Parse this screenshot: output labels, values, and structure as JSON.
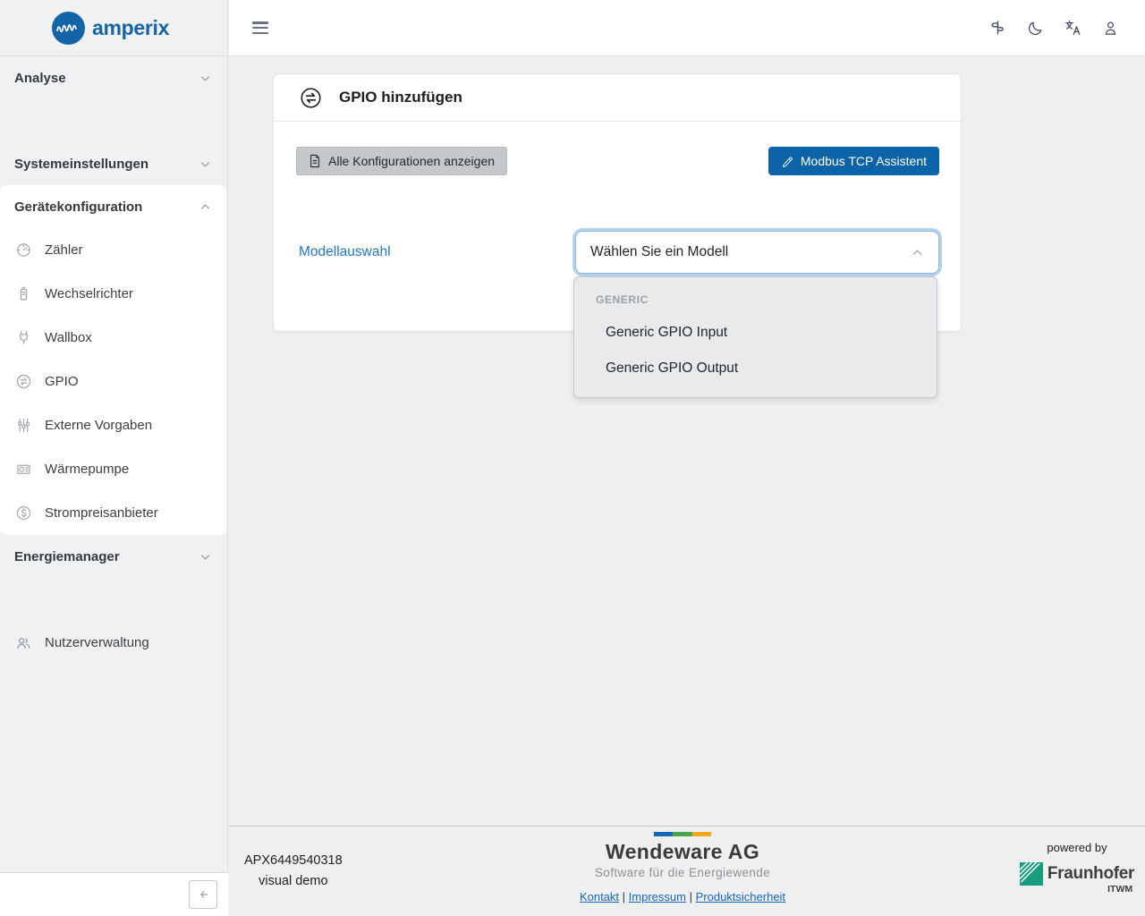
{
  "brand": {
    "name": "amperix"
  },
  "colors": {
    "brand_blue": "#1464a8",
    "button_blue": "#0d63a8",
    "label_blue": "#2377c6",
    "link_blue": "#1766c2",
    "sidebar_bg": "#f0f1f2",
    "content_bg": "#edeff1",
    "fraunhofer_green": "#179c7d",
    "wendeware_bar": [
      "#1268b3",
      "#4ba546",
      "#f5a81c"
    ]
  },
  "icons": {
    "topbar": [
      "signpost-icon",
      "moon-icon",
      "translate-icon",
      "user-icon"
    ],
    "sidebar": [
      "gauge-icon",
      "inverter-icon",
      "plug-icon",
      "swap-arrows-icon",
      "sliders-icon",
      "heat-pump-icon",
      "price-icon",
      "users-icon"
    ],
    "card": [
      "swap-arrows-icon",
      "document-icon",
      "pen-icon"
    ],
    "other": [
      "hamburger-icon",
      "collapse-left-icon",
      "chevron-up-icon",
      "chevron-down-icon"
    ]
  },
  "sidebar": {
    "sections": [
      {
        "label": "Analyse",
        "state": "collapsed"
      },
      {
        "label": "Systemeinstellungen",
        "state": "collapsed"
      },
      {
        "label": "Gerätekonfiguration",
        "state": "expanded",
        "items": [
          "Zähler",
          "Wechselrichter",
          "Wallbox",
          "GPIO",
          "Externe Vorgaben",
          "Wärmepumpe",
          "Strompreisanbieter"
        ]
      },
      {
        "label": "Energiemanager",
        "state": "collapsed"
      }
    ],
    "standalone": "Nutzerverwaltung"
  },
  "main": {
    "card": {
      "title": "GPIO hinzufügen",
      "show_all_button": "Alle Konfigurationen anzeigen",
      "modbus_button": "Modbus TCP Assistent",
      "model_label": "Modellauswahl",
      "select_placeholder": "Wählen Sie ein Modell"
    },
    "dropdown": {
      "group": "GENERIC",
      "options": [
        "Generic GPIO Input",
        "Generic GPIO Output"
      ]
    }
  },
  "footer": {
    "device_id": "APX6449540318",
    "mode": "visual demo",
    "company": "Wendeware AG",
    "tagline": "Software für die Energiewende",
    "links": [
      "Kontakt",
      "Impressum",
      "Produktsicherheit"
    ],
    "separator": "|",
    "powered_by": "powered by",
    "fraunhofer": "Fraunhofer",
    "fraunhofer_sub": "ITWM"
  }
}
